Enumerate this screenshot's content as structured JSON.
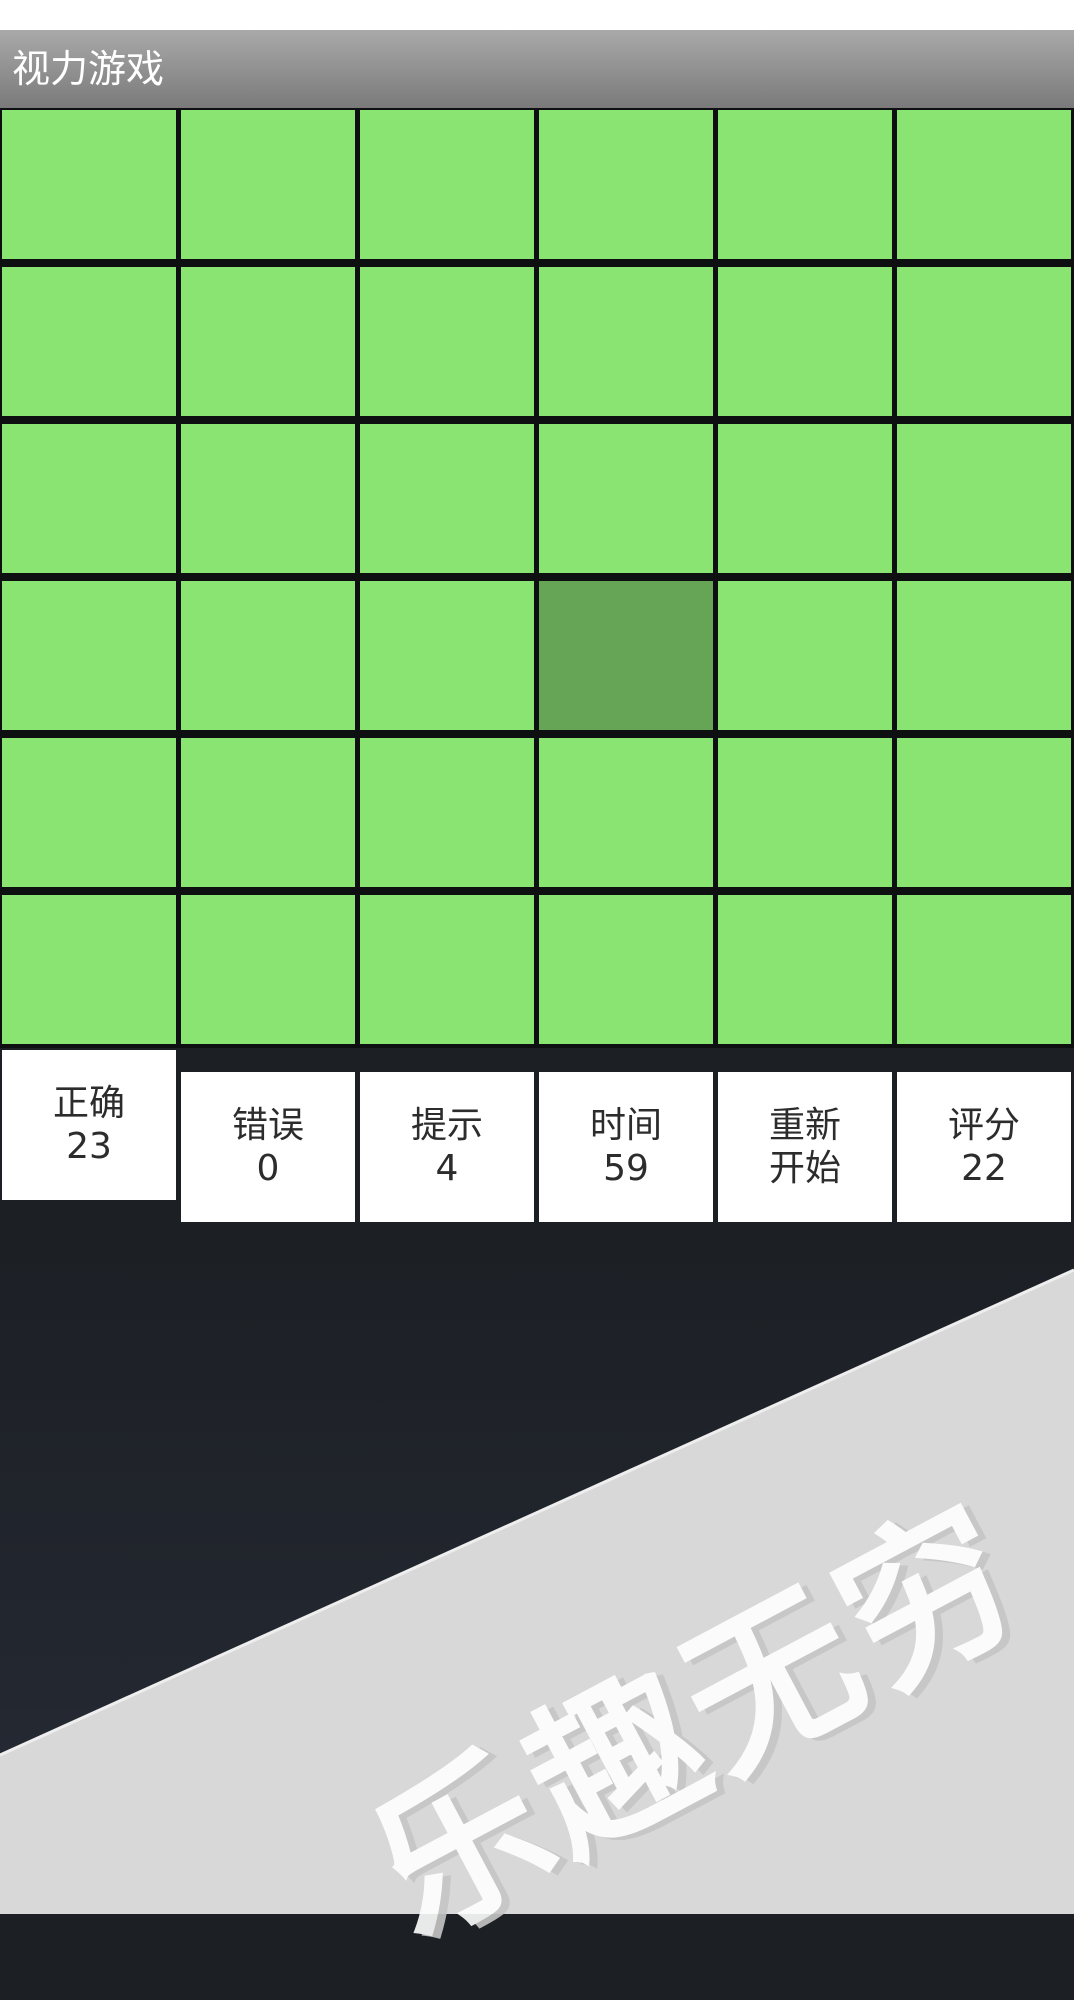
{
  "app": {
    "title": "视力游戏"
  },
  "colors": {
    "tile": "#8ae472",
    "odd_tile": "#65a555",
    "grid_line": "#0e0f10",
    "panel": "#ffffff"
  },
  "board": {
    "rows": 6,
    "cols": 6,
    "odd_tile": {
      "row": 3,
      "col": 3
    }
  },
  "controls": [
    {
      "label": "正确",
      "value": "23"
    },
    {
      "label": "错误",
      "value": "0"
    },
    {
      "label": "提示",
      "value": "4"
    },
    {
      "label": "时间",
      "value": "59"
    },
    {
      "label": "重新",
      "value": "开始"
    },
    {
      "label": "评分",
      "value": "22"
    }
  ],
  "banner": {
    "slogan": "乐趣无穷"
  }
}
